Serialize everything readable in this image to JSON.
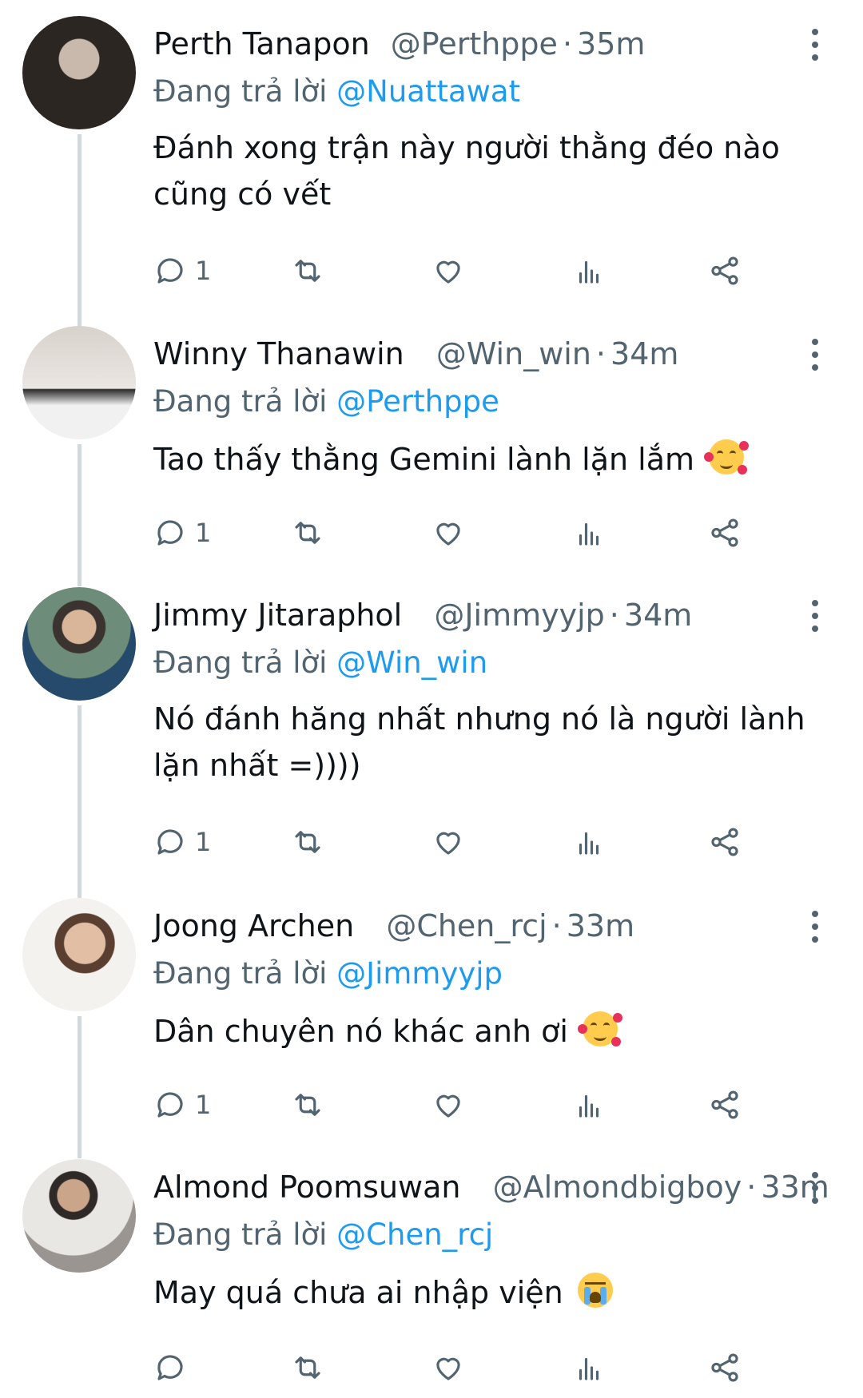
{
  "colors": {
    "link": "#1d9bf0",
    "muted": "#536471",
    "text": "#0f1419",
    "thread_line": "#cfd9de"
  },
  "tweets": [
    {
      "name": "Perth Tanapon",
      "handle": "@Perthppe",
      "time": "35m",
      "reply_prefix": "Đang trả lời",
      "reply_to": "@Nuattawat",
      "text": "Đánh xong trận này người thằng đéo nào cũng có vết",
      "emoji": "",
      "reply_count": "1",
      "avatar_icon": "avatar-photo"
    },
    {
      "name": "Winny Thanawin",
      "handle": "@Win_win",
      "time": "34m",
      "reply_prefix": "Đang trả lời",
      "reply_to": "@Perthppe",
      "text": "Tao thấy thằng Gemini lành lặn lắm",
      "emoji": "smiling-face-with-hearts",
      "reply_count": "1",
      "avatar_icon": "avatar-photo"
    },
    {
      "name": "Jimmy Jitaraphol",
      "handle": "@Jimmyyjp",
      "time": "34m",
      "reply_prefix": "Đang trả lời",
      "reply_to": "@Win_win",
      "text": "Nó đánh hăng nhất nhưng nó là người lành lặn nhất =))))",
      "emoji": "",
      "reply_count": "1",
      "avatar_icon": "avatar-photo"
    },
    {
      "name": "Joong Archen",
      "handle": "@Chen_rcj",
      "time": "33m",
      "reply_prefix": "Đang trả lời",
      "reply_to": "@Jimmyyjp",
      "text": "Dân chuyên nó khác anh ơi",
      "emoji": "smiling-face-with-hearts",
      "reply_count": "1",
      "avatar_icon": "avatar-photo"
    },
    {
      "name": "Almond Poomsuwan",
      "handle": "@Almondbigboy",
      "time": "33m",
      "reply_prefix": "Đang trả lời",
      "reply_to": "@Chen_rcj",
      "text": "May quá chưa ai nhập viện",
      "emoji": "loudly-crying-face",
      "reply_count": "",
      "avatar_icon": "avatar-photo"
    }
  ],
  "icons": {
    "reply": "speech-bubble-icon",
    "retweet": "retweet-icon",
    "like": "heart-icon",
    "views": "bar-chart-icon",
    "share": "share-icon",
    "more": "vertical-ellipsis-icon"
  }
}
